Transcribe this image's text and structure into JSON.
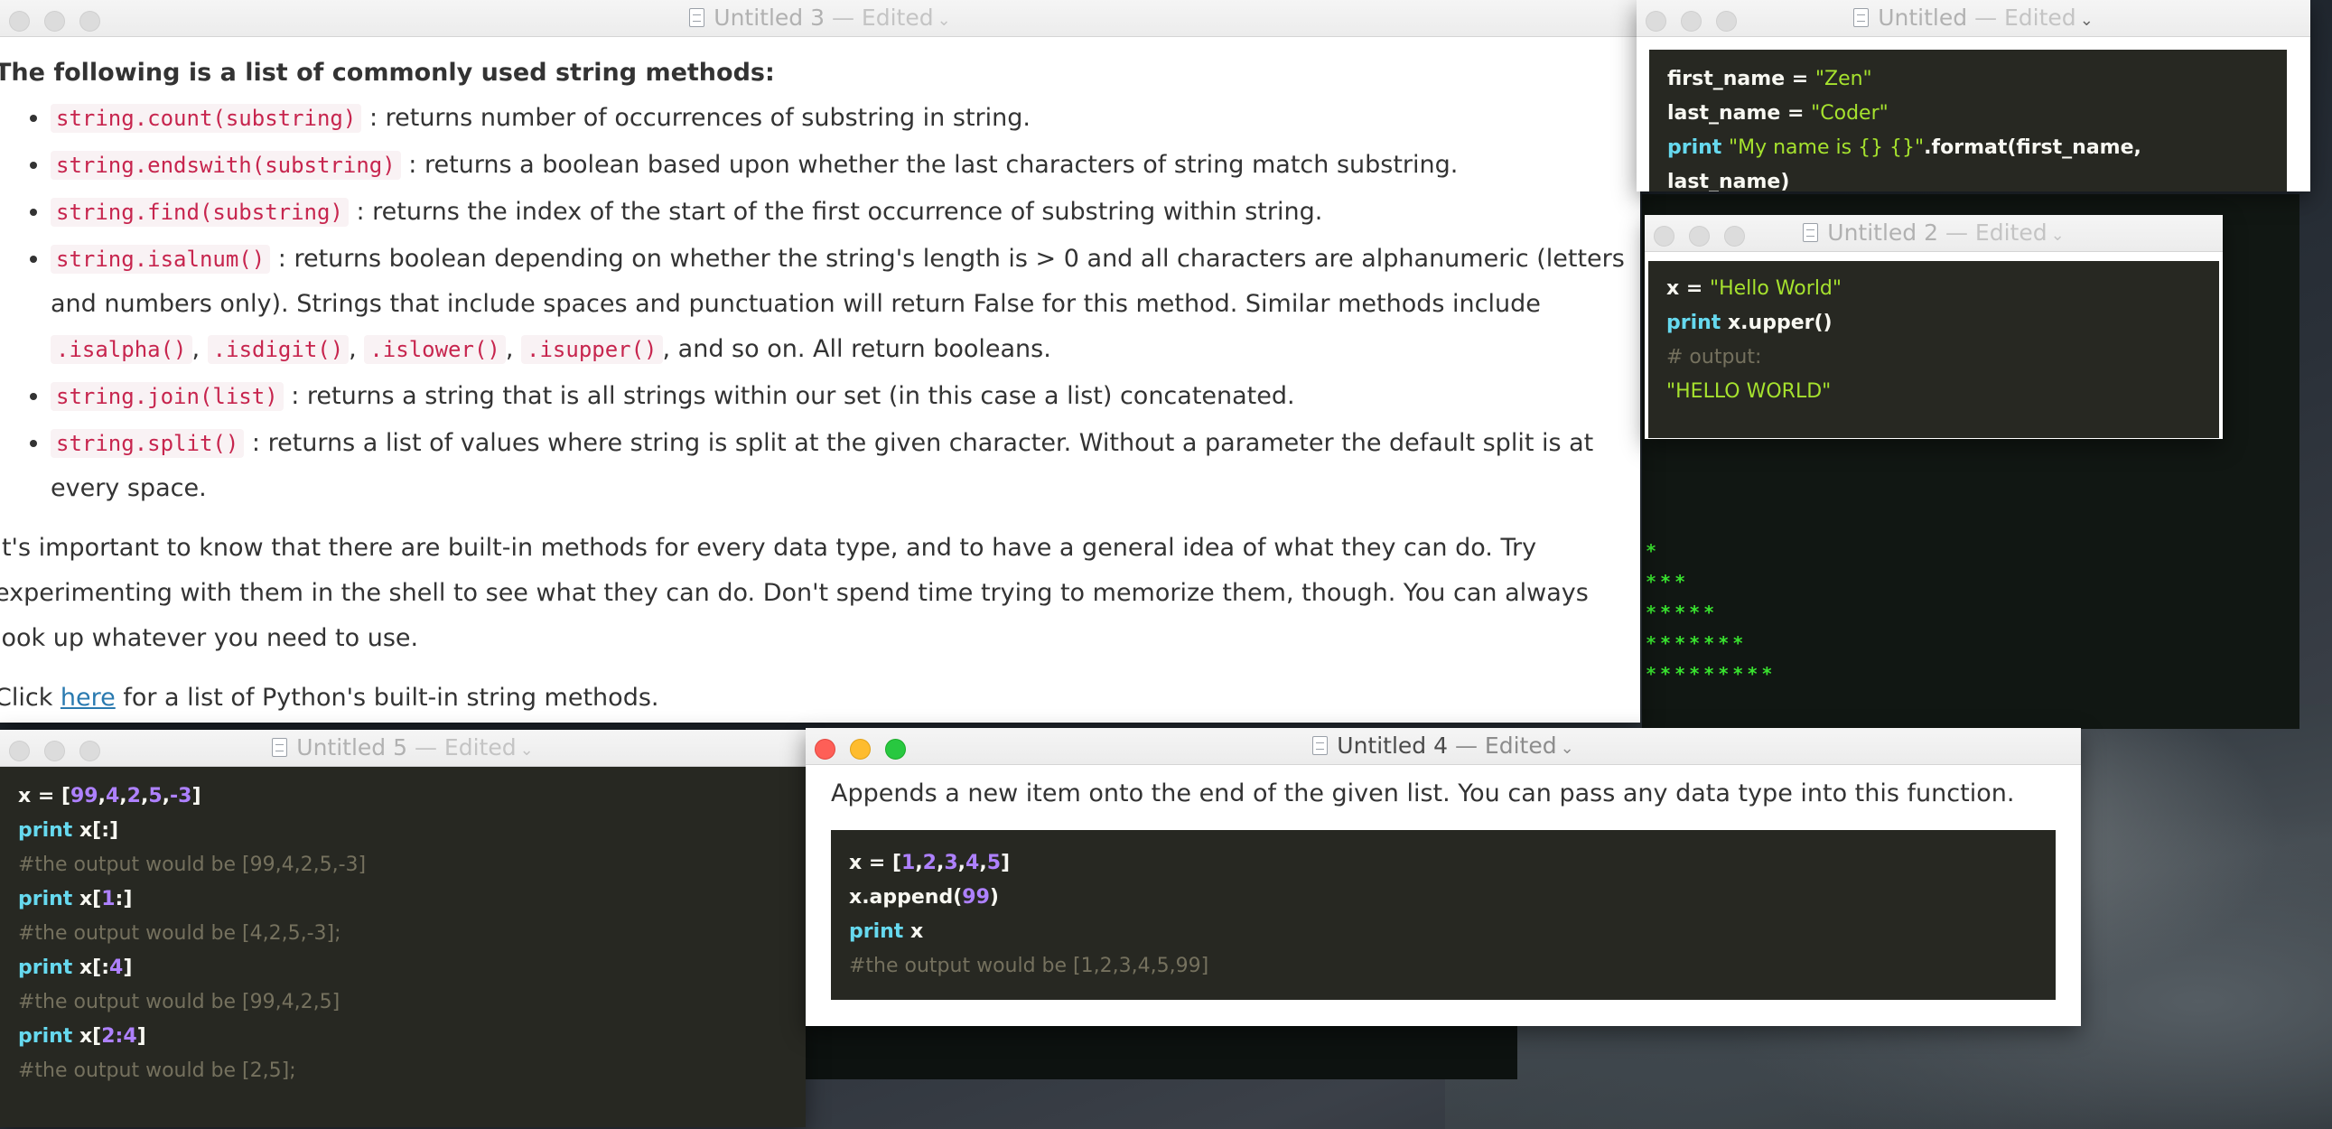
{
  "windows": {
    "untitled3": {
      "title": "Untitled 3",
      "status": "— Edited",
      "heading": "The following is a list of commonly used string methods:",
      "items": [
        {
          "code": "string.count(substring)",
          "text": ": returns number of occurrences of substring in string."
        },
        {
          "code": "string.endswith(substring)",
          "text": ": returns a boolean based upon whether the last characters of string match substring."
        },
        {
          "code": "string.find(substring)",
          "text": ": returns the index of the start of the first occurrence of substring within string."
        },
        {
          "code": "string.isalnum()",
          "text": ": returns boolean depending on whether the string's length is > 0 and all characters are alphanumeric (letters and numbers only). Strings that include spaces and punctuation will return False for this method. Similar methods include",
          "extra_codes": [
            ".isalpha()",
            ".isdigit()",
            ".islower()",
            ".isupper()"
          ],
          "tail": ", and so on. All return booleans."
        },
        {
          "code": "string.join(list)",
          "text": ": returns a string that is all strings within our set (in this case a list) concatenated."
        },
        {
          "code": "string.split()",
          "text": ": returns a list of values where string is split at the given character. Without a parameter the default split is at every space."
        }
      ],
      "paragraph": "It's important to know that there are built-in methods for every data type, and to have a general idea of what they can do. Try experimenting with them in the shell to see what they can do. Don't spend time trying to memorize them, though. You can always look up whatever you need to use.",
      "link_prefix": "Click ",
      "link_text": "here",
      "link_suffix": " for a list of Python's built-in string methods."
    },
    "untitled1": {
      "title": "Untitled",
      "status": "— Edited",
      "code": {
        "line1_var": "first_name",
        "line1_op": " = ",
        "line1_val": "\"Zen\"",
        "line2_var": "last_name",
        "line2_op": " = ",
        "line2_val": "\"Coder\"",
        "line3_kw": "print",
        "line3_str": "\"My name is {} {}\"",
        "line3_rest": ".format(first_name, last_name)"
      }
    },
    "untitled2": {
      "title": "Untitled 2",
      "status": "— Edited",
      "code": {
        "line1_var": "x",
        "line1_op": " = ",
        "line1_val": "\"Hello World\"",
        "line2_kw": "print",
        "line2_rest": " x.upper()",
        "line3_comment": "# output:",
        "line4_val": "\"HELLO WORLD\""
      }
    },
    "untitled5": {
      "title": "Untitled 5",
      "status": "— Edited",
      "code": {
        "line1_prefix": "x = [",
        "line1_nums": [
          "99",
          "4",
          "2",
          "5",
          "-3"
        ],
        "line1_suffix": "]",
        "line2_kw": "print",
        "line2_rest": " x[:]",
        "line3_comment": "#the output would be [99,4,2,5,-3]",
        "line4_kw": "print",
        "line4_pre": " x[",
        "line4_num": "1",
        "line4_post": ":]",
        "line5_comment": "#the output would be [4,2,5,-3];",
        "line6_kw": "print",
        "line6_pre": " x[:",
        "line6_num": "4",
        "line6_post": "]",
        "line7_comment": "#the output would be [99,4,2,5]",
        "line8_kw": "print",
        "line8_pre": " x[",
        "line8_num": "2:4",
        "line8_post": "]",
        "line9_comment": "#the output would be [2,5];"
      }
    },
    "untitled4": {
      "title": "Untitled 4",
      "status": "— Edited",
      "description": "Appends a new item onto the end of the given list. You can pass any data type into this function.",
      "code": {
        "line1_prefix": "x = [",
        "line1_nums": [
          "1",
          "2",
          "3",
          "4",
          "5"
        ],
        "line1_suffix": "]",
        "line2_pre": "x.append(",
        "line2_num": "99",
        "line2_post": ")",
        "line3_kw": "print",
        "line3_rest": " x",
        "line4_comment": "#the output would be [1,2,3,4,5,99]"
      }
    }
  },
  "terminal": {
    "lines": [
      "*",
      "***",
      "*****",
      "*******",
      "*********"
    ]
  },
  "colors": {
    "code_bg": "#272822",
    "keyword": "#66d9ef",
    "string": "#a6e22e",
    "number": "#ae81ff",
    "comment": "#75715e",
    "inline_code": "#c7254e",
    "terminal_green": "#39e22f"
  }
}
